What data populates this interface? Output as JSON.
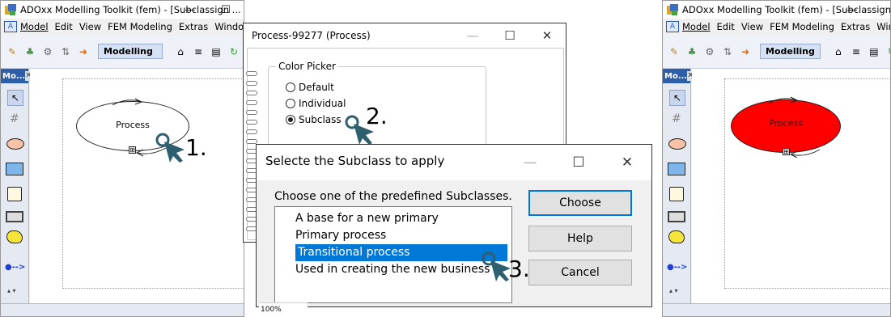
{
  "window1": {
    "title": "ADOxx Modelling Toolkit (fem) - [Subclassign ...",
    "controls": {
      "minimize": "—",
      "maximize": "☐",
      "close": "✕"
    },
    "menu": [
      "Model",
      "Edit",
      "View",
      "FEM Modeling",
      "Extras",
      "Window"
    ],
    "mode": "Modelling",
    "panel_title": "Mo...",
    "panel_close": "✕",
    "shape_label": "Process",
    "expand_symbol": "⊞"
  },
  "window2": {
    "title": "ADOxx Modelling Toolkit (fem) - [Subclassign ...",
    "controls": {
      "minimize": "—"
    },
    "menu": [
      "Model",
      "Edit",
      "View",
      "FEM Modeling",
      "Extras",
      "Window"
    ],
    "mode": "Modelling",
    "panel_title": "Mo...",
    "panel_close": "✕",
    "shape_label": "Process",
    "shape_color": "#ff0000",
    "expand_symbol": "⊞"
  },
  "process_dialog": {
    "title": "Process-99277 (Process)",
    "controls": {
      "minimize": "—",
      "maximize": "☐",
      "close": "✕"
    },
    "group_label": "Color Picker",
    "options": [
      {
        "label": "Default",
        "selected": false
      },
      {
        "label": "Individual",
        "selected": false
      },
      {
        "label": "Subclass",
        "selected": true
      }
    ],
    "zoom": "100%"
  },
  "subclass_dialog": {
    "title": "Selecte the Subclass to apply",
    "controls": {
      "minimize": "—",
      "maximize": "☐",
      "close": "✕"
    },
    "prompt": "Choose one of the predefined Subclasses.",
    "items": [
      "A base for a new primary",
      "Primary process",
      "Transitional process",
      "Used in creating the new business"
    ],
    "selected_index": 2,
    "buttons": {
      "choose": "Choose",
      "help": "Help",
      "cancel": "Cancel"
    }
  },
  "steps": [
    "1.",
    "2.",
    "3."
  ],
  "colors": {
    "accent": "#0078d7",
    "cursor": "#2e5f6e",
    "fill_red": "#ff0000"
  }
}
